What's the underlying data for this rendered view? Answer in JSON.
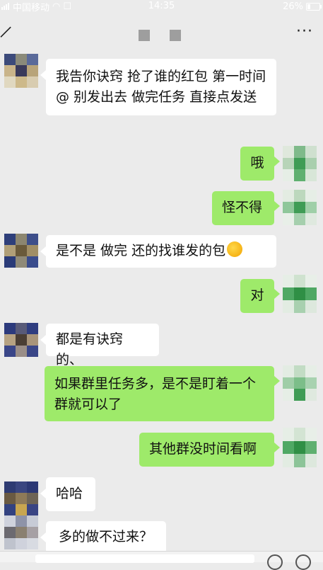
{
  "status_bar": {
    "carrier": "中国移动",
    "time": "14:35",
    "battery": "26%",
    "battery_level": 0.26
  },
  "nav": {
    "back_icon": "back-arrow-icon",
    "more_label": "···"
  },
  "messages": [
    {
      "side": "left",
      "text": "我告你诀窍    抢了谁的红包 第一时间@   别发出去  做完任务 直接点发送"
    },
    {
      "side": "right",
      "text": "哦"
    },
    {
      "side": "right",
      "text": "怪不得"
    },
    {
      "side": "left",
      "text": "是不是  做完 还的找谁发的包",
      "emoji": "crying-laughing-emoji"
    },
    {
      "side": "right",
      "text": "对"
    },
    {
      "side": "left",
      "text": "都是有诀窍的、"
    },
    {
      "side": "right",
      "text": "如果群里任务多，是不是盯着一个群就可以了"
    },
    {
      "side": "right",
      "text": "其他群没时间看啊"
    },
    {
      "side": "left",
      "text": "哈哈"
    },
    {
      "side": "left",
      "text": "多的做不过来？"
    }
  ],
  "colors": {
    "background": "#ebebeb",
    "bubble_sent": "#9eea6a",
    "bubble_received": "#ffffff"
  }
}
